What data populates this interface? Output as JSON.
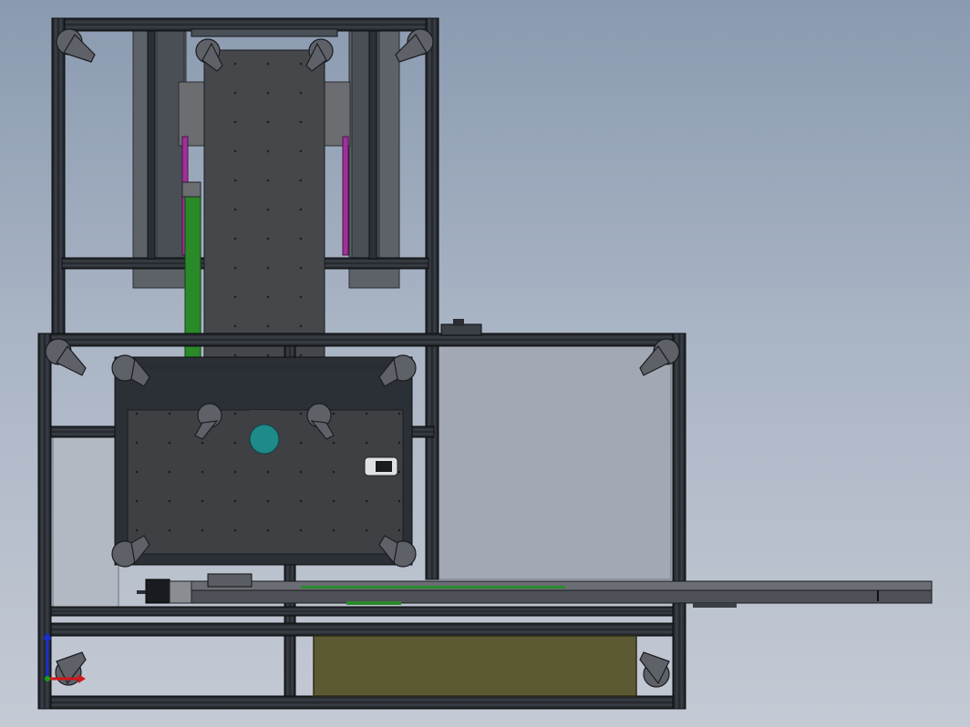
{
  "view": {
    "type": "CAD top view",
    "background": [
      "#8a9ab0",
      "#c4cad4"
    ]
  },
  "colors": {
    "frame": "#2b2f36",
    "frame_edge": "#111317",
    "frame_light": "#4a5058",
    "plate": "#45474b",
    "plate_dark": "#3a3c40",
    "panel_gray": "#5d6168",
    "green_strip": "#2a8a2a",
    "magenta_strip": "#a0309a",
    "teal_disc": "#1f8a8a",
    "olive_block": "#5b5a32",
    "glass_panel": "#a3a9b4",
    "bracket": "#5e6168",
    "rail": "#6a6e74",
    "triad_x": "#d01818",
    "triad_y": "#1830d0",
    "triad_z": "#18a018"
  },
  "components": [
    {
      "name": "upper-frame",
      "icon": "aluminium-profile-frame"
    },
    {
      "name": "lower-frame",
      "icon": "aluminium-profile-frame"
    },
    {
      "name": "vertical-carriage-plate",
      "icon": "slotted-plate"
    },
    {
      "name": "base-plate",
      "icon": "slotted-plate"
    },
    {
      "name": "linear-rail",
      "icon": "rail"
    },
    {
      "name": "stepper-motor",
      "icon": "motor"
    },
    {
      "name": "battery-block",
      "icon": "box"
    },
    {
      "name": "coordinate-triad",
      "icon": "axis-triad"
    }
  ]
}
